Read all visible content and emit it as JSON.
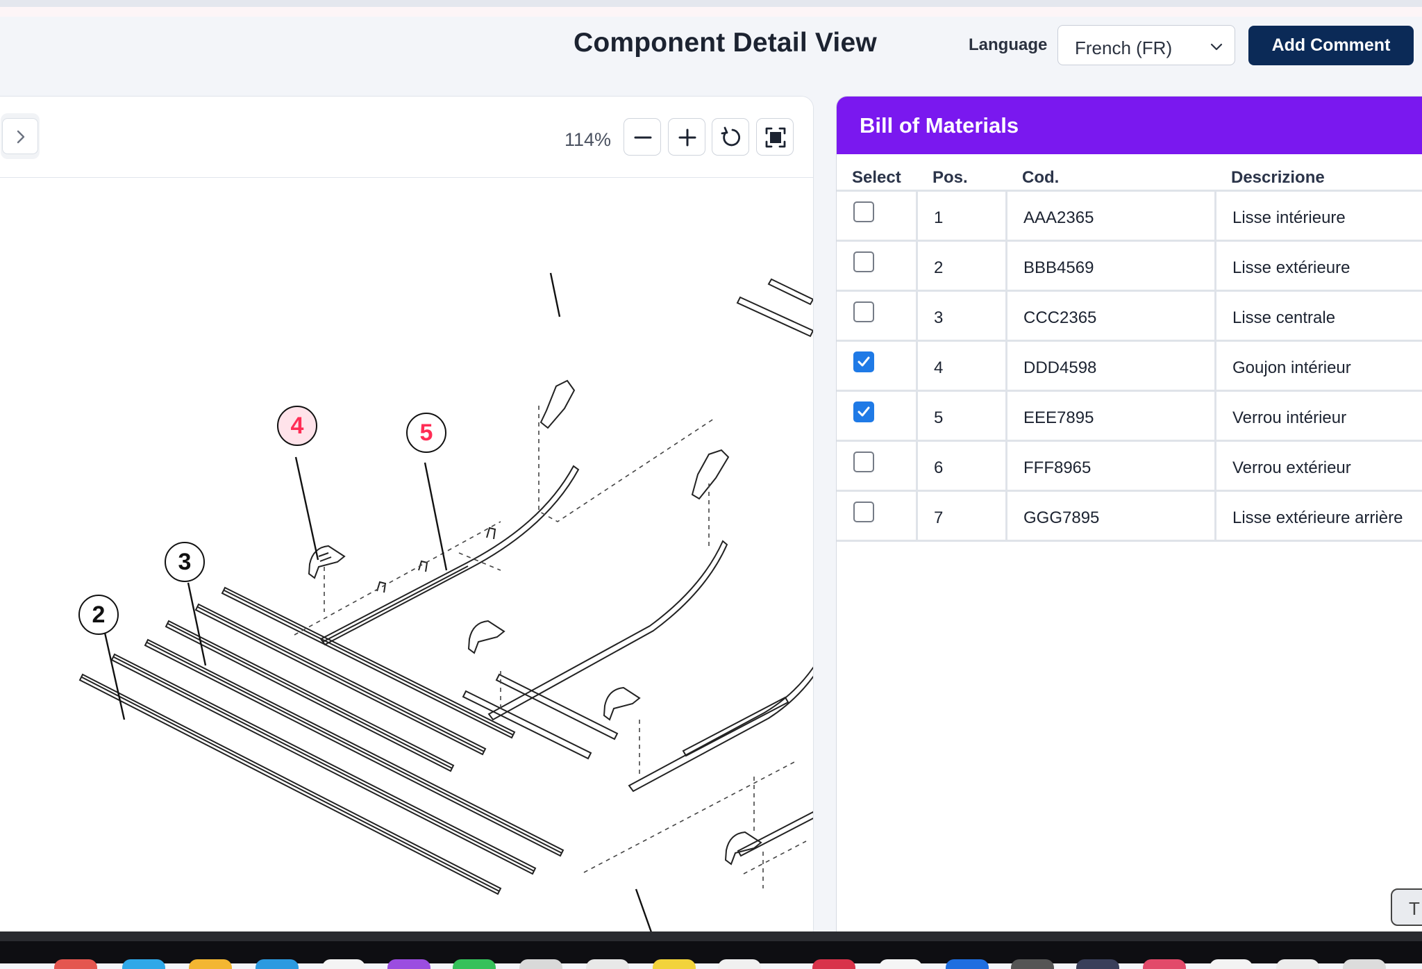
{
  "header": {
    "title": "Component Detail View",
    "language_label": "Language",
    "language_value": "French (FR)",
    "add_comment_label": "Add Comment"
  },
  "viewer": {
    "zoom_label": "114%",
    "tools": [
      "zoom-out",
      "zoom-in",
      "rotate",
      "fit-to-screen"
    ],
    "callouts": [
      {
        "label": "4",
        "highlighted": true
      },
      {
        "label": "5",
        "highlighted": true
      },
      {
        "label": "3",
        "highlighted": false
      },
      {
        "label": "2",
        "highlighted": false
      }
    ]
  },
  "bom": {
    "title": "Bill of Materials",
    "columns": [
      "Select",
      "Pos.",
      "Cod.",
      "Descrizione"
    ],
    "rows": [
      {
        "checked": false,
        "pos": "1",
        "cod": "AAA2365",
        "desc": "Lisse intérieure"
      },
      {
        "checked": false,
        "pos": "2",
        "cod": "BBB4569",
        "desc": "Lisse extérieure"
      },
      {
        "checked": false,
        "pos": "3",
        "cod": "CCC2365",
        "desc": "Lisse centrale"
      },
      {
        "checked": true,
        "pos": "4",
        "cod": "DDD4598",
        "desc": "Goujon intérieur"
      },
      {
        "checked": true,
        "pos": "5",
        "cod": "EEE7895",
        "desc": "Verrou intérieur"
      },
      {
        "checked": false,
        "pos": "6",
        "cod": "FFF8965",
        "desc": "Verrou extérieur"
      },
      {
        "checked": false,
        "pos": "7",
        "cod": "GGG7895",
        "desc": "Lisse extérieure arrière"
      }
    ]
  },
  "floating_tab_label": "T",
  "colors": {
    "accent_purple": "#7a18ef",
    "primary_navy": "#0b2a57",
    "checkbox_blue": "#1f7ae6",
    "callout_highlight": "#ff2d55"
  }
}
